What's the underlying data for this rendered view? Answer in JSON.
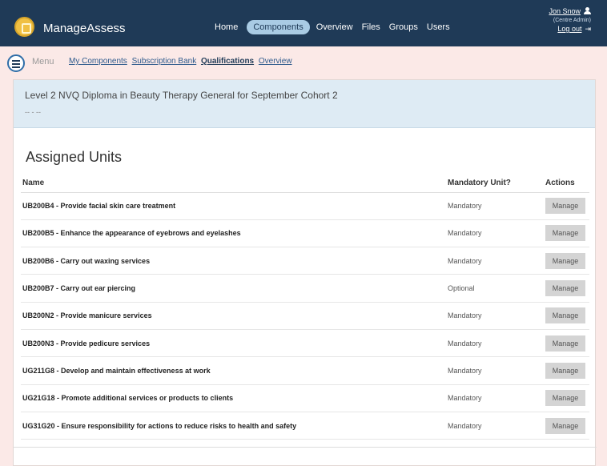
{
  "header": {
    "brand": "ManageAssess",
    "nav": [
      "Home",
      "Components",
      "Overview",
      "Files",
      "Groups",
      "Users"
    ],
    "active_nav": "Components",
    "user_name": "Jon Snow",
    "user_role": "(Centre Admin)",
    "logout": "Log out"
  },
  "subnav": {
    "menu_label": "Menu",
    "links": [
      "My Components",
      "Subscription Bank",
      "Qualifications",
      "Overview"
    ],
    "current": "Qualifications"
  },
  "qualification": {
    "title": "Level 2 NVQ Diploma in Beauty Therapy General for September Cohort 2",
    "subtitle": "-- - --"
  },
  "section_title": "Assigned Units",
  "table": {
    "headers": [
      "Name",
      "Mandatory Unit?",
      "Actions"
    ],
    "rows": [
      {
        "name": "UB200B4 - Provide facial skin care treatment",
        "mandatory": "Mandatory",
        "action": "Manage"
      },
      {
        "name": "UB200B5 - Enhance the appearance of eyebrows and eyelashes",
        "mandatory": "Mandatory",
        "action": "Manage"
      },
      {
        "name": "UB200B6 - Carry out waxing services",
        "mandatory": "Mandatory",
        "action": "Manage"
      },
      {
        "name": "UB200B7 - Carry out ear piercing",
        "mandatory": "Optional",
        "action": "Manage"
      },
      {
        "name": "UB200N2 - Provide manicure services",
        "mandatory": "Mandatory",
        "action": "Manage"
      },
      {
        "name": "UB200N3 - Provide pedicure services",
        "mandatory": "Mandatory",
        "action": "Manage"
      },
      {
        "name": "UG211G8 - Develop and maintain effectiveness at work",
        "mandatory": "Mandatory",
        "action": "Manage"
      },
      {
        "name": "UG21G18 - Promote additional services or products to clients",
        "mandatory": "Mandatory",
        "action": "Manage"
      },
      {
        "name": "UG31G20 - Ensure responsibility for actions to reduce risks to health and safety",
        "mandatory": "Mandatory",
        "action": "Manage"
      }
    ]
  },
  "colors": {
    "header_bg": "#1f3a57",
    "active_pill": "#a9cbe4",
    "page_bg": "#fbe9e7",
    "banner_bg": "#deebf4"
  },
  "icons": [
    "app-logo-icon",
    "user-icon",
    "logout-icon",
    "menu-icon"
  ]
}
